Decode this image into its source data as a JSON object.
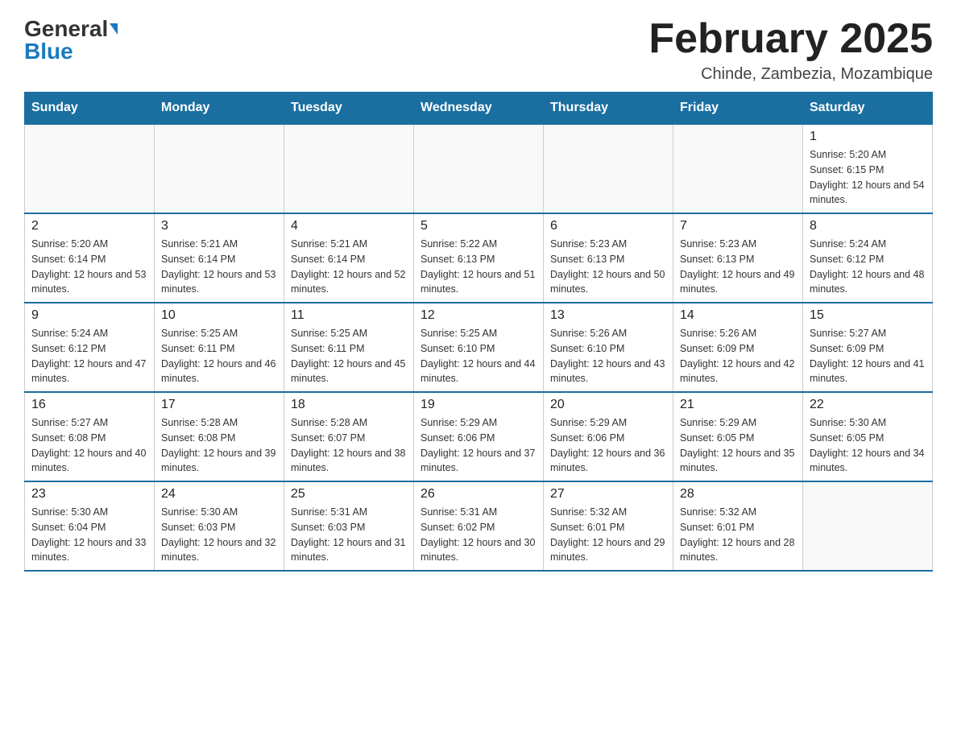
{
  "header": {
    "logo_line1": "General",
    "logo_line2": "Blue",
    "month_title": "February 2025",
    "location": "Chinde, Zambezia, Mozambique"
  },
  "days_of_week": [
    "Sunday",
    "Monday",
    "Tuesday",
    "Wednesday",
    "Thursday",
    "Friday",
    "Saturday"
  ],
  "weeks": [
    [
      {
        "day": "",
        "info": ""
      },
      {
        "day": "",
        "info": ""
      },
      {
        "day": "",
        "info": ""
      },
      {
        "day": "",
        "info": ""
      },
      {
        "day": "",
        "info": ""
      },
      {
        "day": "",
        "info": ""
      },
      {
        "day": "1",
        "info": "Sunrise: 5:20 AM\nSunset: 6:15 PM\nDaylight: 12 hours and 54 minutes."
      }
    ],
    [
      {
        "day": "2",
        "info": "Sunrise: 5:20 AM\nSunset: 6:14 PM\nDaylight: 12 hours and 53 minutes."
      },
      {
        "day": "3",
        "info": "Sunrise: 5:21 AM\nSunset: 6:14 PM\nDaylight: 12 hours and 53 minutes."
      },
      {
        "day": "4",
        "info": "Sunrise: 5:21 AM\nSunset: 6:14 PM\nDaylight: 12 hours and 52 minutes."
      },
      {
        "day": "5",
        "info": "Sunrise: 5:22 AM\nSunset: 6:13 PM\nDaylight: 12 hours and 51 minutes."
      },
      {
        "day": "6",
        "info": "Sunrise: 5:23 AM\nSunset: 6:13 PM\nDaylight: 12 hours and 50 minutes."
      },
      {
        "day": "7",
        "info": "Sunrise: 5:23 AM\nSunset: 6:13 PM\nDaylight: 12 hours and 49 minutes."
      },
      {
        "day": "8",
        "info": "Sunrise: 5:24 AM\nSunset: 6:12 PM\nDaylight: 12 hours and 48 minutes."
      }
    ],
    [
      {
        "day": "9",
        "info": "Sunrise: 5:24 AM\nSunset: 6:12 PM\nDaylight: 12 hours and 47 minutes."
      },
      {
        "day": "10",
        "info": "Sunrise: 5:25 AM\nSunset: 6:11 PM\nDaylight: 12 hours and 46 minutes."
      },
      {
        "day": "11",
        "info": "Sunrise: 5:25 AM\nSunset: 6:11 PM\nDaylight: 12 hours and 45 minutes."
      },
      {
        "day": "12",
        "info": "Sunrise: 5:25 AM\nSunset: 6:10 PM\nDaylight: 12 hours and 44 minutes."
      },
      {
        "day": "13",
        "info": "Sunrise: 5:26 AM\nSunset: 6:10 PM\nDaylight: 12 hours and 43 minutes."
      },
      {
        "day": "14",
        "info": "Sunrise: 5:26 AM\nSunset: 6:09 PM\nDaylight: 12 hours and 42 minutes."
      },
      {
        "day": "15",
        "info": "Sunrise: 5:27 AM\nSunset: 6:09 PM\nDaylight: 12 hours and 41 minutes."
      }
    ],
    [
      {
        "day": "16",
        "info": "Sunrise: 5:27 AM\nSunset: 6:08 PM\nDaylight: 12 hours and 40 minutes."
      },
      {
        "day": "17",
        "info": "Sunrise: 5:28 AM\nSunset: 6:08 PM\nDaylight: 12 hours and 39 minutes."
      },
      {
        "day": "18",
        "info": "Sunrise: 5:28 AM\nSunset: 6:07 PM\nDaylight: 12 hours and 38 minutes."
      },
      {
        "day": "19",
        "info": "Sunrise: 5:29 AM\nSunset: 6:06 PM\nDaylight: 12 hours and 37 minutes."
      },
      {
        "day": "20",
        "info": "Sunrise: 5:29 AM\nSunset: 6:06 PM\nDaylight: 12 hours and 36 minutes."
      },
      {
        "day": "21",
        "info": "Sunrise: 5:29 AM\nSunset: 6:05 PM\nDaylight: 12 hours and 35 minutes."
      },
      {
        "day": "22",
        "info": "Sunrise: 5:30 AM\nSunset: 6:05 PM\nDaylight: 12 hours and 34 minutes."
      }
    ],
    [
      {
        "day": "23",
        "info": "Sunrise: 5:30 AM\nSunset: 6:04 PM\nDaylight: 12 hours and 33 minutes."
      },
      {
        "day": "24",
        "info": "Sunrise: 5:30 AM\nSunset: 6:03 PM\nDaylight: 12 hours and 32 minutes."
      },
      {
        "day": "25",
        "info": "Sunrise: 5:31 AM\nSunset: 6:03 PM\nDaylight: 12 hours and 31 minutes."
      },
      {
        "day": "26",
        "info": "Sunrise: 5:31 AM\nSunset: 6:02 PM\nDaylight: 12 hours and 30 minutes."
      },
      {
        "day": "27",
        "info": "Sunrise: 5:32 AM\nSunset: 6:01 PM\nDaylight: 12 hours and 29 minutes."
      },
      {
        "day": "28",
        "info": "Sunrise: 5:32 AM\nSunset: 6:01 PM\nDaylight: 12 hours and 28 minutes."
      },
      {
        "day": "",
        "info": ""
      }
    ]
  ]
}
